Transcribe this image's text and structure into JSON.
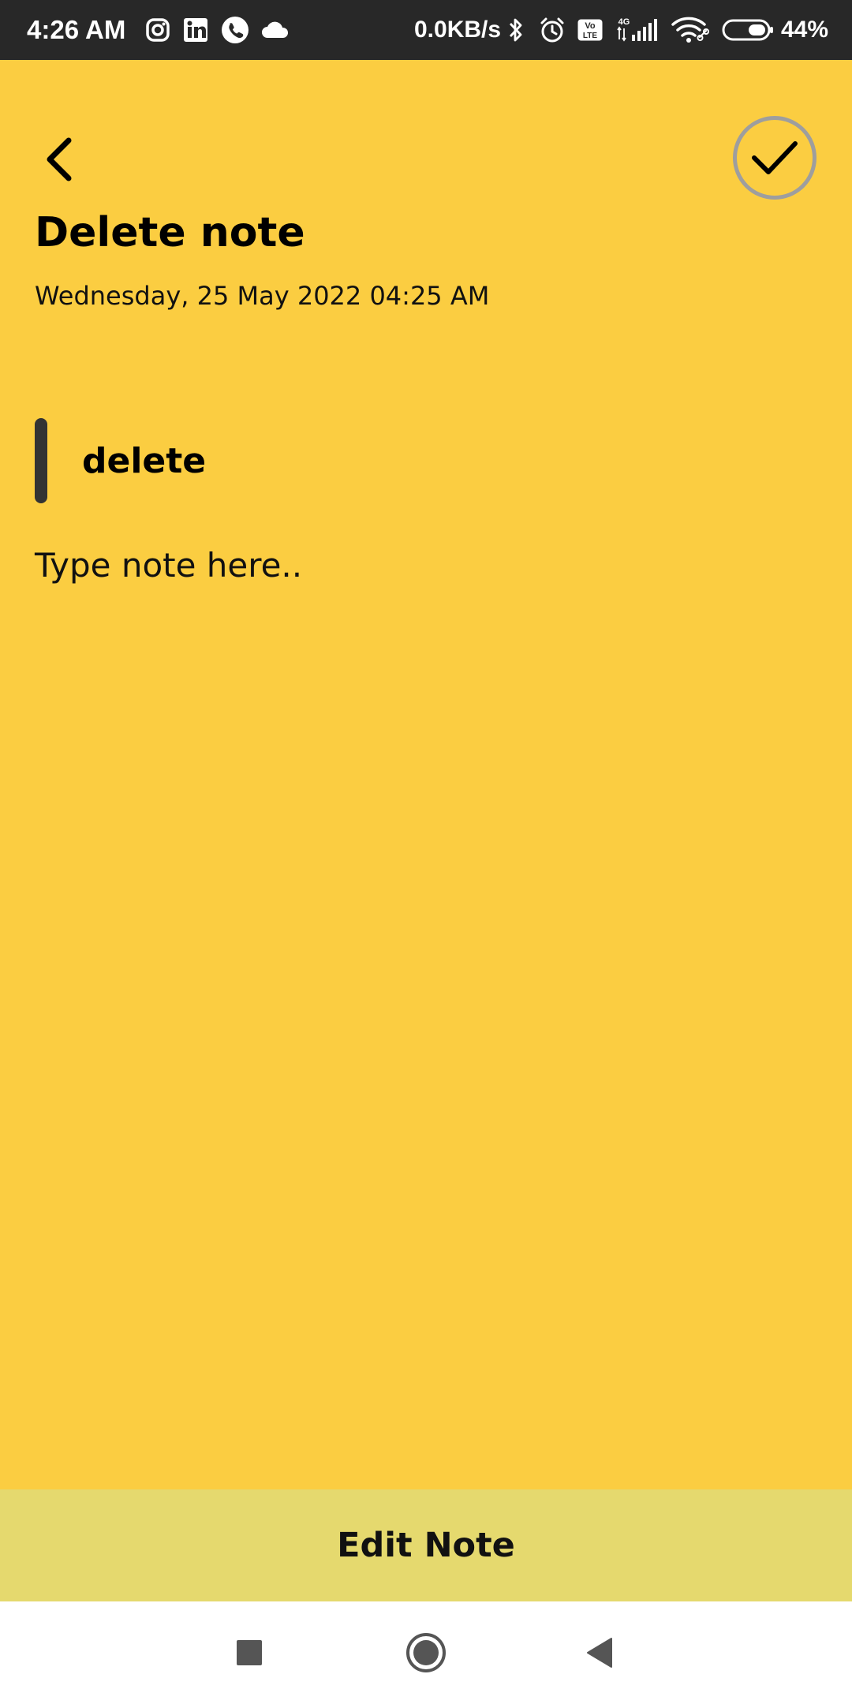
{
  "status_bar": {
    "time": "4:26 AM",
    "network_speed": "0.0KB/s",
    "battery_percent": "44%",
    "battery_level": 0.44,
    "left_icons": [
      "instagram-icon",
      "linkedin-icon",
      "whatsapp-icon",
      "cloud-icon"
    ],
    "right_icons": [
      "bluetooth-icon",
      "alarm-icon",
      "volte-icon",
      "signal-4g-icon",
      "wifi-icon",
      "battery-icon"
    ],
    "volte_label": "Vo LTE",
    "network_type": "4G"
  },
  "toolbar": {
    "back_icon": "back-chevron-icon",
    "save_icon": "checkmark-icon"
  },
  "note": {
    "title": "Delete note",
    "date": "Wednesday, 25 May 2022 04:25 AM",
    "subtitle": "delete",
    "body_placeholder": "Type note here.."
  },
  "actions": {
    "edit_label": "Edit Note"
  },
  "navigation": {
    "buttons": [
      "recent-apps-icon",
      "home-icon",
      "back-icon"
    ]
  },
  "colors": {
    "background": "#FBCD41",
    "status_bar": "#282828",
    "edit_bar": "#E5D96E",
    "nav_bar": "#FFFFFF",
    "subtitle_indicator": "#333333",
    "save_button_border": "#9E9E9E"
  }
}
